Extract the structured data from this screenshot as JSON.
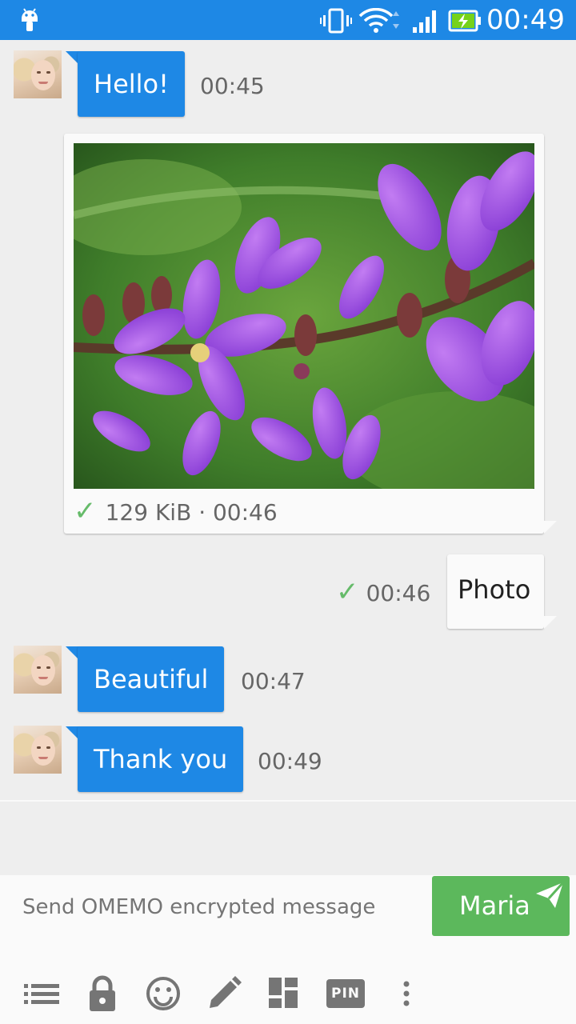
{
  "status_bar": {
    "time": "00:49"
  },
  "messages": [
    {
      "direction": "in",
      "text": "Hello!",
      "time": "00:45"
    },
    {
      "direction": "out",
      "type": "image",
      "status": "✓",
      "meta": "129 KiB · 00:46"
    },
    {
      "direction": "out",
      "text": "Photo",
      "status": "✓",
      "time": "00:46"
    },
    {
      "direction": "in",
      "text": "Beautiful",
      "time": "00:47"
    },
    {
      "direction": "in",
      "text": "Thank you",
      "time": "00:49"
    }
  ],
  "compose": {
    "placeholder": "Send OMEMO encrypted message",
    "send_label": "Maria"
  },
  "toolbar": {
    "icons": [
      "list-icon",
      "lock-icon",
      "emoji-icon",
      "pencil-icon",
      "dashboard-icon",
      "pin-icon",
      "more-vert-icon"
    ],
    "pin_label": "PIN"
  },
  "colors": {
    "accent": "#1e88e5",
    "send": "#5cb85c",
    "check": "#66bb6a"
  }
}
